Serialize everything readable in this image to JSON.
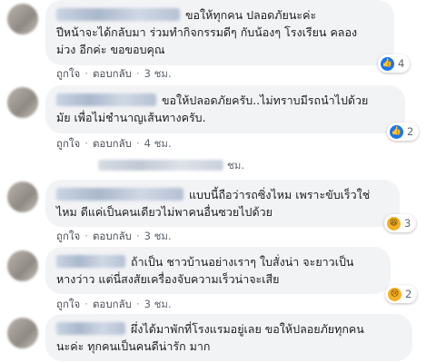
{
  "comments": [
    {
      "lines": [
        "ขอให้ทุกคน ปลอดภัยนะค่ะ",
        "ปีหน้าจะได้กลับมา ร่วมทำกิจกรรมดีๆ กับน้องๆ โรงเรียน คลอง",
        "ม่วง อีกค่ะ ขอขอบคุณ"
      ],
      "like_label": "ถูกใจ",
      "reply_label": "ตอบกลับ",
      "time": "3 ชม.",
      "reaction_count": "4"
    },
    {
      "lines": [
        "ขอให้ปลอดภัยครับ..ไม่ทราบมีรถนำไปด้วย",
        "มัย เพื่อไม่ชำนาญเส้นทางครับ."
      ],
      "like_label": "ถูกใจ",
      "reply_label": "ตอบกลับ",
      "time": "4 ชม.",
      "reaction_count": "2"
    },
    {
      "collapsed_time": "ชม."
    },
    {
      "lines": [
        "แบบนี้ถือว่ารถซิ่งไหม เพราะขับเร็วใช่",
        "ไหม ดีแค่เป็นคนเดียวไม่พาคนอื่นซวยไปด้วย"
      ],
      "like_label": "ถูกใจ",
      "reply_label": "ตอบกลับ",
      "time": "3 ชม.",
      "reaction_count": "3"
    },
    {
      "lines": [
        "ถ้าเป็น ชาวบ้านอย่างเราๆ ใบสั่งน่า จะยาวเป็น",
        "หางว่าว แต่นี่สงสัยเครื่องจับความเร็วน่าจะเสีย"
      ],
      "like_label": "ถูกใจ",
      "reply_label": "ตอบกลับ",
      "time": "3 ชม.",
      "reaction_count": "2"
    },
    {
      "lines": [
        "ผึ่งได้มาพักที่โรงแรมอยู่เลย ขอให้ปลอยภัยทุกคน",
        "นะค่ะ ทุกคนเป็นคนดีน่ารัก มาก"
      ]
    }
  ]
}
